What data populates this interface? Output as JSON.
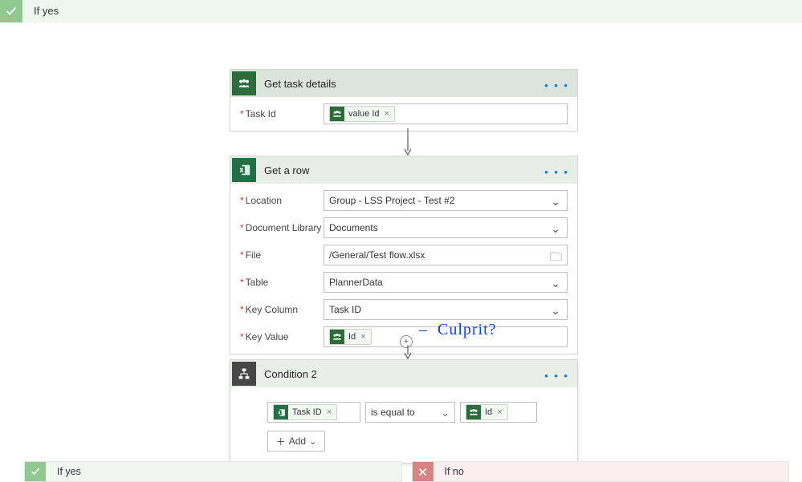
{
  "ifYesTop": {
    "label": "If yes"
  },
  "getTask": {
    "title": "Get task details",
    "taskIdLabel": "Task Id",
    "tokenLabel": "value Id"
  },
  "getRow": {
    "title": "Get a row",
    "fields": {
      "locationLabel": "Location",
      "locationValue": "Group - LSS Project - Test #2",
      "docLibLabel": "Document Library",
      "docLibValue": "Documents",
      "fileLabel": "File",
      "fileValue": "/General/Test flow.xlsx",
      "tableLabel": "Table",
      "tableValue": "PlannerData",
      "keyColLabel": "Key Column",
      "keyColValue": "Task ID",
      "keyValLabel": "Key Value",
      "keyValToken": "Id"
    }
  },
  "condition": {
    "title": "Condition 2",
    "leftToken": "Task ID",
    "operator": "is equal to",
    "rightToken": "Id",
    "addLabel": "Add"
  },
  "branches": {
    "yes": "If yes",
    "no": "If no"
  },
  "annotation": "Culprit?"
}
